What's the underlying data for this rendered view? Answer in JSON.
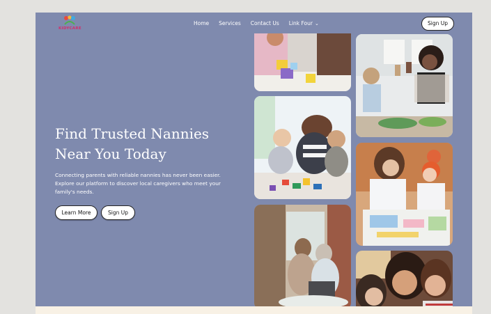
{
  "brand": {
    "name": "KIDYCARE"
  },
  "nav": {
    "items": [
      "Home",
      "Services",
      "Contact Us",
      "Link Four"
    ]
  },
  "header": {
    "signup_label": "Sign Up"
  },
  "hero": {
    "title_line1": "Find Trusted Nannies",
    "title_line2": "Near You Today",
    "subtitle": "Connecting parents with reliable nannies has never been easier. Explore our platform to discover local caregivers who meet your family's needs.",
    "learn_more_label": "Learn More",
    "signup_label": "Sign Up"
  },
  "colors": {
    "hero_bg": "#7f8aae",
    "page_bg": "#e3e2df",
    "brand_pink": "#d22e6c",
    "strip": "#f8f1e5"
  },
  "icons": [
    "logo-mark-icon",
    "chevron-down-icon"
  ]
}
